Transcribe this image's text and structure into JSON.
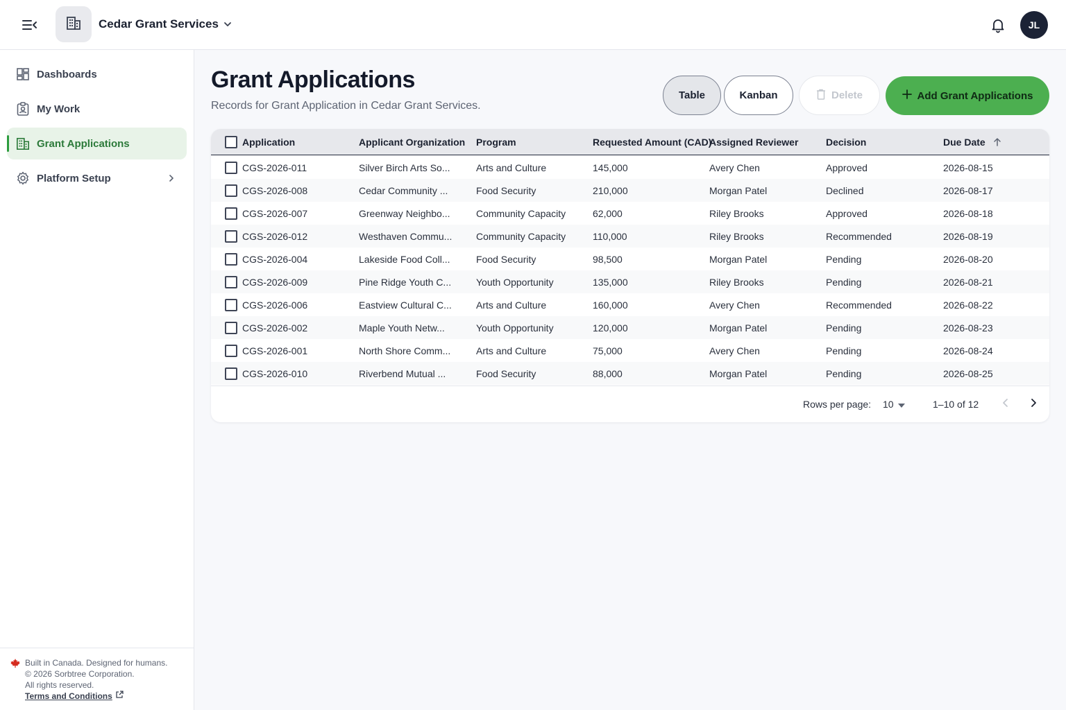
{
  "header": {
    "org_name": "Cedar Grant Services",
    "user_initials": "JL",
    "accent_color": "#4caf50"
  },
  "sidebar": {
    "items": [
      {
        "label": "Dashboards",
        "icon": "dashboard-icon",
        "active": false
      },
      {
        "label": "My Work",
        "icon": "badge-icon",
        "active": false
      },
      {
        "label": "Grant Applications",
        "icon": "building-icon",
        "active": true
      },
      {
        "label": "Platform Setup",
        "icon": "gear-icon",
        "active": false
      }
    ],
    "footer": {
      "line1": "Built in Canada. Designed for humans.",
      "line2": "© 2026 Sorbtree Corporation.",
      "line3": "All rights reserved.",
      "terms": "Terms and Conditions"
    }
  },
  "main": {
    "title": "Grant Applications",
    "subtitle": "Records for Grant Application in Cedar Grant Services.",
    "buttons": {
      "table": "Table",
      "kanban": "Kanban",
      "delete": "Delete",
      "add": "Add Grant Applications"
    }
  },
  "table": {
    "columns": [
      "Application",
      "Applicant Organization",
      "Program",
      "Requested Amount (CAD)",
      "Assigned Reviewer",
      "Decision",
      "Due Date"
    ],
    "rows": [
      [
        "CGS-2026-011",
        "Silver Birch Arts So...",
        "Arts and Culture",
        "145,000",
        "Avery Chen",
        "Approved",
        "2026-08-15"
      ],
      [
        "CGS-2026-008",
        "Cedar Community ...",
        "Food Security",
        "210,000",
        "Morgan Patel",
        "Declined",
        "2026-08-17"
      ],
      [
        "CGS-2026-007",
        "Greenway Neighbo...",
        "Community Capacity",
        "62,000",
        "Riley Brooks",
        "Approved",
        "2026-08-18"
      ],
      [
        "CGS-2026-012",
        "Westhaven Commu...",
        "Community Capacity",
        "110,000",
        "Riley Brooks",
        "Recommended",
        "2026-08-19"
      ],
      [
        "CGS-2026-004",
        "Lakeside Food Coll...",
        "Food Security",
        "98,500",
        "Morgan Patel",
        "Pending",
        "2026-08-20"
      ],
      [
        "CGS-2026-009",
        "Pine Ridge Youth C...",
        "Youth Opportunity",
        "135,000",
        "Riley Brooks",
        "Pending",
        "2026-08-21"
      ],
      [
        "CGS-2026-006",
        "Eastview Cultural C...",
        "Arts and Culture",
        "160,000",
        "Avery Chen",
        "Recommended",
        "2026-08-22"
      ],
      [
        "CGS-2026-002",
        "Maple Youth Netw...",
        "Youth Opportunity",
        "120,000",
        "Morgan Patel",
        "Pending",
        "2026-08-23"
      ],
      [
        "CGS-2026-001",
        "North Shore Comm...",
        "Arts and Culture",
        "75,000",
        "Avery Chen",
        "Pending",
        "2026-08-24"
      ],
      [
        "CGS-2026-010",
        "Riverbend Mutual ...",
        "Food Security",
        "88,000",
        "Morgan Patel",
        "Pending",
        "2026-08-25"
      ]
    ],
    "sort": {
      "column": "Due Date",
      "direction": "ascending"
    },
    "footer": {
      "rows_per_page_label": "Rows per page:",
      "rows_per_page_value": "10",
      "range": "1–10 of 12"
    }
  }
}
